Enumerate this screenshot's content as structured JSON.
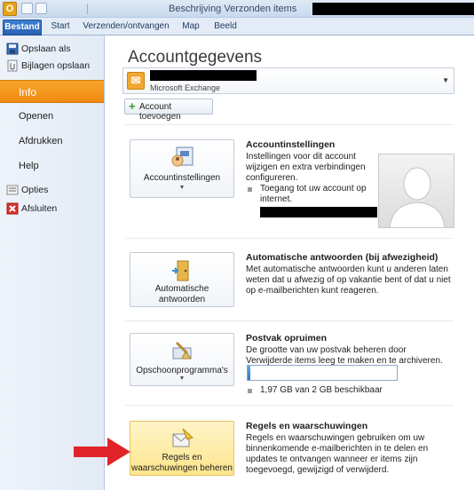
{
  "ribbon": {
    "app_icon": "O",
    "tabs": [
      "Bestand",
      "Start",
      "Verzenden/ontvangen",
      "Map",
      "Beeld"
    ],
    "title_fragment": "Beschrijving  Verzonden items"
  },
  "nav": {
    "items": [
      {
        "label": "Opslaan als",
        "icon": "save-icon"
      },
      {
        "label": "Bijlagen opslaan",
        "icon": "attachment-icon"
      },
      {
        "label": "Info",
        "selected": true
      },
      {
        "label": "Openen"
      },
      {
        "label": "Afdrukken"
      },
      {
        "label": "Help"
      },
      {
        "label": "Opties",
        "icon": "options-icon"
      },
      {
        "label": "Afsluiten",
        "icon": "exit-icon"
      }
    ]
  },
  "main": {
    "title": "Accountgegevens",
    "account_type": "Microsoft Exchange",
    "add_account_label": "Account toevoegen",
    "sections": [
      {
        "button_label": "Accountinstellingen",
        "title": "Accountinstellingen",
        "text": "Instellingen voor dit account wijzigen en extra verbindingen configureren.",
        "bullet": "Toegang tot uw account op internet."
      },
      {
        "button_label_1": "Automatische",
        "button_label_2": "antwoorden",
        "title": "Automatische antwoorden (bij afwezigheid)",
        "text": "Met automatische antwoorden kunt u anderen laten weten dat u afwezig of op vakantie bent of dat u niet op e-mailberichten kunt reageren."
      },
      {
        "button_label": "Opschoonprogramma's",
        "title": "Postvak opruimen",
        "text": "De grootte van uw postvak beheren door Verwijderde items leeg te maken en te archiveren.",
        "bullet": "1,97 GB van 2 GB beschikbaar",
        "usage_fraction": 0.015
      },
      {
        "button_label_1": "Regels en",
        "button_label_2": "waarschuwingen beheren",
        "title": "Regels en waarschuwingen",
        "text": "Regels en waarschuwingen gebruiken om uw binnenkomende e-mailberichten in te delen en updates te ontvangen wanneer er items zijn toegevoegd, gewijzigd of verwijderd."
      }
    ]
  },
  "colors": {
    "accent_orange": "#f08a12",
    "tab_blue": "#2a62b0",
    "arrow_red": "#e0242a"
  }
}
